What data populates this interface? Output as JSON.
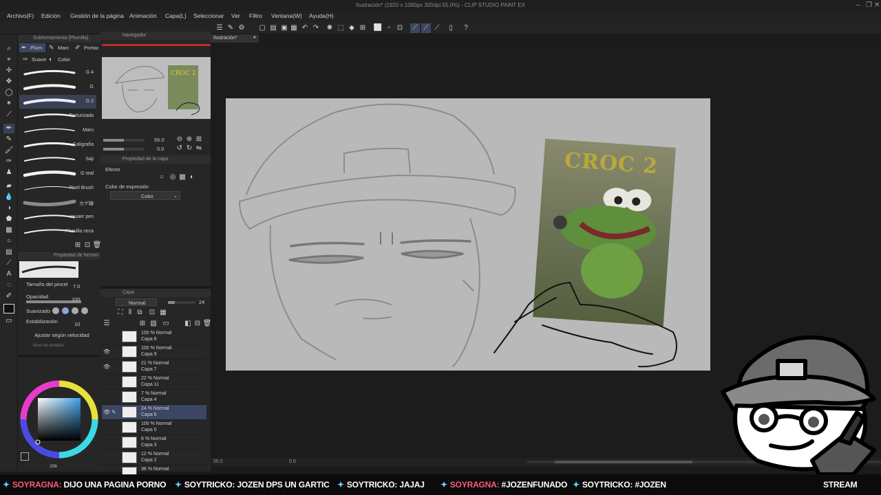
{
  "window": {
    "title": "Ilustración* (1920 x 1080px 300dpi 55.0%) - CLIP STUDIO PAINT EX"
  },
  "menu": [
    "Archivo(F)",
    "Edición",
    "Gestión de la página",
    "Animación",
    "Capa(L)",
    "Seleccionar",
    "Ver",
    "Filtro",
    "Ventana(W)",
    "Ayuda(H)"
  ],
  "subtool_panel": {
    "title": "Subherramienta [Plumilla]",
    "tabs": [
      "Plum",
      "Marc",
      "Portac"
    ],
    "subtabs": [
      "Suave",
      "Color"
    ],
    "brushes": [
      {
        "name": "G 4",
        "selected": false
      },
      {
        "name": "G",
        "selected": false
      },
      {
        "name": "G 2",
        "selected": true
      },
      {
        "name": "Texturizada",
        "selected": false
      },
      {
        "name": "Maru",
        "selected": false
      },
      {
        "name": "Caligrafía",
        "selected": false
      },
      {
        "name": "Saji",
        "selected": false
      },
      {
        "name": "G real",
        "selected": false
      },
      {
        "name": "Pixel Brush",
        "selected": false
      },
      {
        "name": "カゲ線",
        "selected": false
      },
      {
        "name": "squaer pen",
        "selected": false
      },
      {
        "name": "Plumilla seca",
        "selected": false
      }
    ]
  },
  "navigator": {
    "title": "Navegador",
    "zoom": "55.0",
    "rotation": "0.0"
  },
  "layer_property": {
    "title": "Propiedad de la capa",
    "effect_label": "Efecto",
    "expression_color_label": "Color de expresión",
    "expression_color_value": "Color"
  },
  "tool_property": {
    "title": "Propiedad de herram",
    "brush_size_label": "Tamaño del pincel",
    "brush_size": "7.0",
    "opacity_label": "Opacidad",
    "opacity": "100",
    "smoothing_label": "Suavizado",
    "stabilization_label": "Estabilización",
    "stabilization": "10",
    "speed_adjust_label": "Ajustar según velocidad",
    "stabilization_hint": "Nivel de estabiliz."
  },
  "layer_panel": {
    "title": "Capa",
    "blend_mode": "Normal",
    "opacity": "24",
    "layers": [
      {
        "opacity": "100 % Normal",
        "name": "Capa 8",
        "visible": false,
        "selected": false
      },
      {
        "opacity": "100 % Normal",
        "name": "Capa 9",
        "visible": true,
        "selected": false
      },
      {
        "opacity": "21 % Normal",
        "name": "Capa 7",
        "visible": true,
        "selected": false
      },
      {
        "opacity": "22 % Normal",
        "name": "Capa 11",
        "visible": false,
        "selected": false
      },
      {
        "opacity": "7 % Normal",
        "name": "Capa 4",
        "visible": false,
        "selected": false
      },
      {
        "opacity": "24 % Normal",
        "name": "Capa 6",
        "visible": true,
        "selected": true
      },
      {
        "opacity": "100 % Normal",
        "name": "Capa 5",
        "visible": false,
        "selected": false
      },
      {
        "opacity": "8 % Normal",
        "name": "Capa 3",
        "visible": false,
        "selected": false
      },
      {
        "opacity": "12 % Normal",
        "name": "Capa 2",
        "visible": false,
        "selected": false
      },
      {
        "opacity": "36 % Normal",
        "name": "",
        "visible": false,
        "selected": false
      }
    ]
  },
  "color_panel": {
    "value_label": "206"
  },
  "document": {
    "tab": "Ilustración*",
    "reference_title": "CROC 2"
  },
  "status": {
    "zoom": "55.0",
    "angle": "0.0"
  },
  "chat": [
    {
      "user": "SOYRAGNA:",
      "text": "DIJO UNA PAGINA PORNO"
    },
    {
      "user": "SOYTRICKO:",
      "text": "JOZEN DPS UN GARTIC"
    },
    {
      "user": "SOYTRICKO:",
      "text": "JAJAJ"
    },
    {
      "user": "SOYRAGNA:",
      "text": "#JOZENFUNADO"
    },
    {
      "user": "SOYTRICKO:",
      "text": "#JOZEN"
    },
    {
      "user": "",
      "text": "STREAM"
    }
  ]
}
